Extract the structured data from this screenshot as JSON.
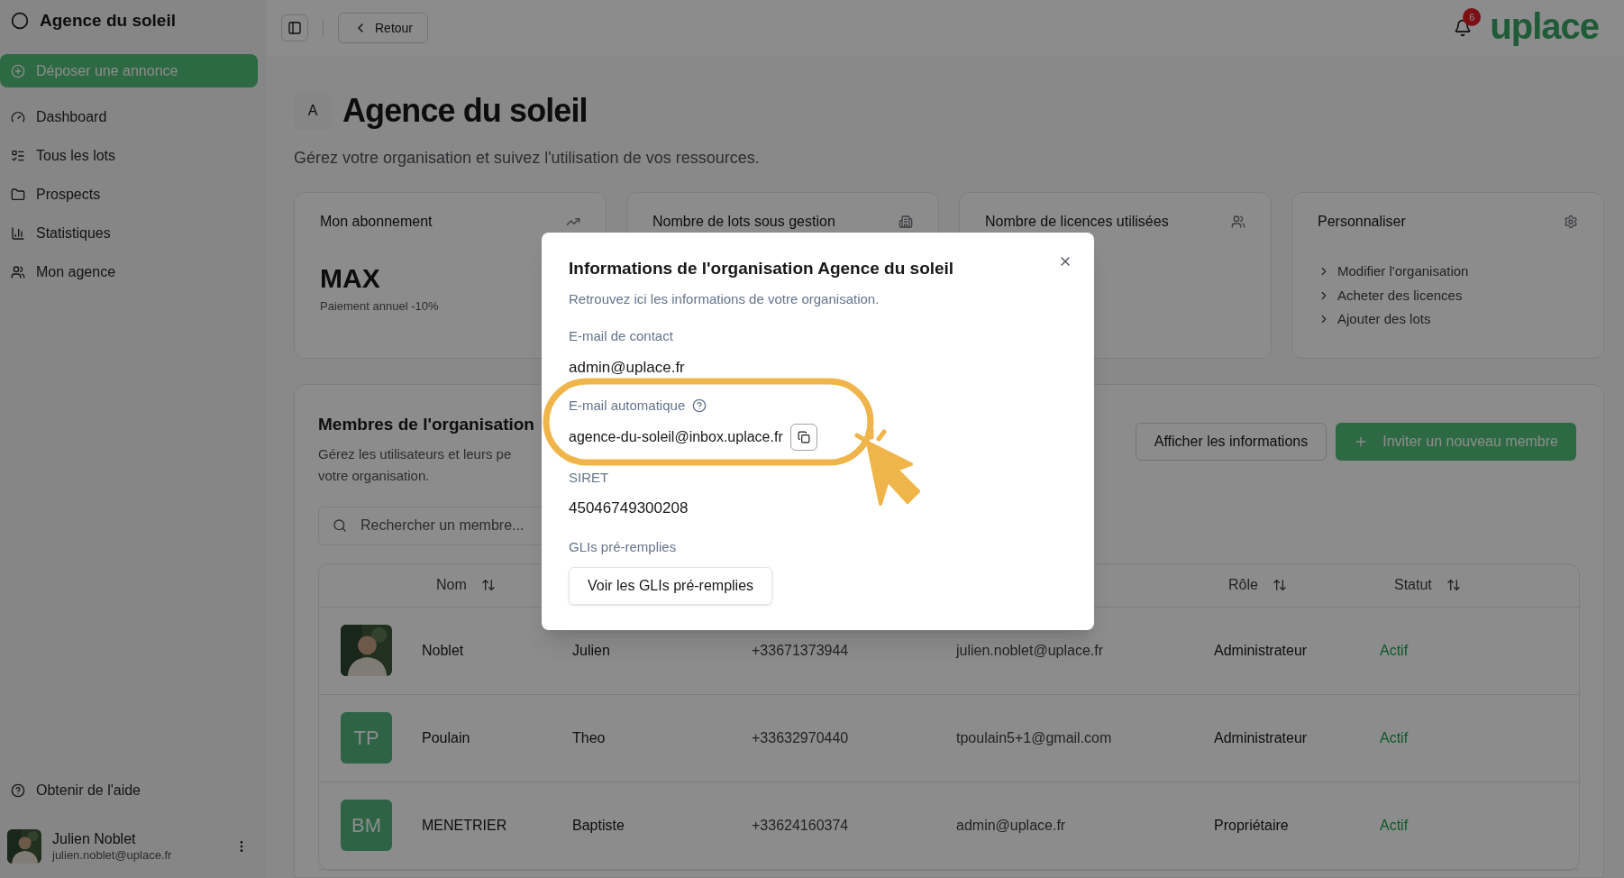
{
  "sidebar": {
    "org_name": "Agence du soleil",
    "primary_action": "Déposer une annonce",
    "items": [
      {
        "label": "Dashboard"
      },
      {
        "label": "Tous les lots"
      },
      {
        "label": "Prospects"
      },
      {
        "label": "Statistiques"
      },
      {
        "label": "Mon agence"
      }
    ],
    "help": "Obtenir de l'aide",
    "user": {
      "name": "Julien Noblet",
      "email": "julien.noblet@uplace.fr"
    }
  },
  "topbar": {
    "back": "Retour",
    "notifications": "6",
    "logo": "uplace"
  },
  "page": {
    "avatar": "A",
    "title": "Agence du soleil",
    "subtitle": "Gérez votre organisation et suivez l'utilisation de vos ressources."
  },
  "cards": [
    {
      "title": "Mon abonnement",
      "value": "MAX",
      "note": "Paiement annuel -10%"
    },
    {
      "title": "Nombre de lots sous gestion"
    },
    {
      "title": "Nombre de licences utilisées"
    },
    {
      "title": "Personnaliser",
      "links": [
        "Modifier l'organisation",
        "Acheter des licences",
        "Ajouter des lots"
      ]
    }
  ],
  "members": {
    "title": "Membres de l'organisation",
    "description": [
      "Gérez les utilisateurs et leurs pe",
      "votre organisation."
    ],
    "buttons": [
      "Afficher les informations",
      "Inviter un nouveau membre"
    ],
    "search": {
      "placeholder": "Rechercher un membre..."
    },
    "table": {
      "columns": [
        {
          "label": "Nom"
        },
        {
          "label": "Rôle"
        },
        {
          "label": "Statut"
        }
      ],
      "rows": [
        {
          "last_name": "Noblet",
          "first_name": "Julien",
          "phone": "+33671373944",
          "email": "julien.noblet@uplace.fr",
          "role": "Administrateur",
          "status": "Actif"
        },
        {
          "avatar": {
            "kind": "initials",
            "text": "TP"
          },
          "last_name": "Poulain",
          "first_name": "Theo",
          "phone": "+33632970440",
          "email": "tpoulain5+1@gmail.com",
          "role": "Administrateur",
          "status": "Actif"
        },
        {
          "avatar": {
            "kind": "initials",
            "text": "BM"
          },
          "last_name": "MENETRIER",
          "first_name": "Baptiste",
          "phone": "+33624160374",
          "email": "admin@uplace.fr",
          "role": "Propriétaire",
          "status": "Actif"
        }
      ]
    }
  },
  "dialog": {
    "title": "Informations de l'organisation Agence du soleil",
    "subtitle": "Retrouvez ici les informations de votre organisation.",
    "fields": [
      {
        "kind": "text",
        "label": "E-mail de contact",
        "value": "admin@uplace.fr"
      },
      {
        "kind": "copy",
        "label": "E-mail automatique",
        "value": "agence-du-soleil@inbox.uplace.fr",
        "help": true,
        "highlighted": true
      },
      {
        "kind": "text",
        "label": "SIRET",
        "value": "45046749300208"
      },
      {
        "kind": "button",
        "label": "GLIs pré-remplies",
        "value": "Voir les GLIs pré-remplies"
      }
    ]
  }
}
